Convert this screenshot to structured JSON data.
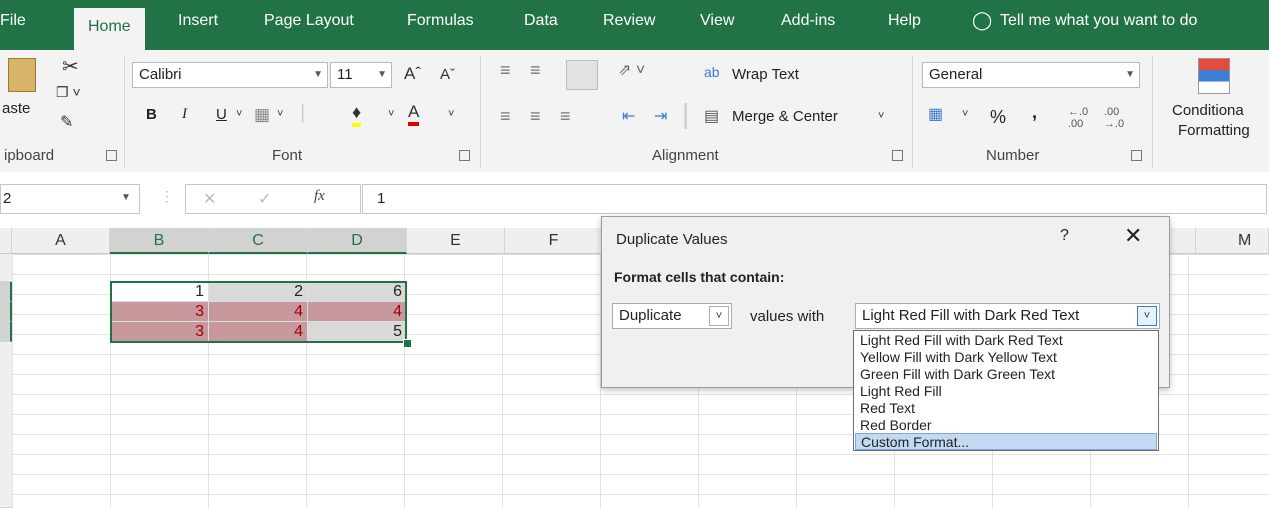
{
  "ribbon_tabs": [
    "File",
    "Home",
    "Insert",
    "Page Layout",
    "Formulas",
    "Data",
    "Review",
    "View",
    "Add-ins",
    "Help"
  ],
  "active_tab": "Home",
  "tell_me": "Tell me what you want to do",
  "clipboard": {
    "paste": "aste",
    "group": "ipboard"
  },
  "font": {
    "name": "Calibri",
    "size": "11",
    "group": "Font",
    "bold": "B",
    "italic": "I",
    "underline": "U"
  },
  "alignment": {
    "wrap": "Wrap Text",
    "merge": "Merge & Center",
    "group": "Alignment"
  },
  "number": {
    "format": "General",
    "percent": "%",
    "comma": ",",
    "group": "Number"
  },
  "styles": {
    "cond_line1": "Conditiona",
    "cond_line2": "Formatting"
  },
  "formula_bar": {
    "name_box": "2",
    "fx": "fx",
    "value": "1"
  },
  "columns": [
    "A",
    "B",
    "C",
    "D",
    "E",
    "F",
    "M"
  ],
  "cells": {
    "b1": "1",
    "c1": "2",
    "d1": "6",
    "b2": "3",
    "c2": "4",
    "d2": "4",
    "b3": "3",
    "c3": "4",
    "d3": "5"
  },
  "dialog": {
    "title": "Duplicate Values",
    "help": "?",
    "prompt": "Format cells that contain:",
    "rule": "Duplicate",
    "values_with": "values with",
    "format": "Light Red Fill with Dark Red Text"
  },
  "dropdown_options": [
    "Light Red Fill with Dark Red Text",
    "Yellow Fill with Dark Yellow Text",
    "Green Fill with Dark Green Text",
    "Light Red Fill",
    "Red Text",
    "Red Border",
    "Custom Format..."
  ],
  "colors": {
    "excel_green": "#217346",
    "dup_fill": "#c7989c",
    "dup_text": "#9c0006"
  }
}
